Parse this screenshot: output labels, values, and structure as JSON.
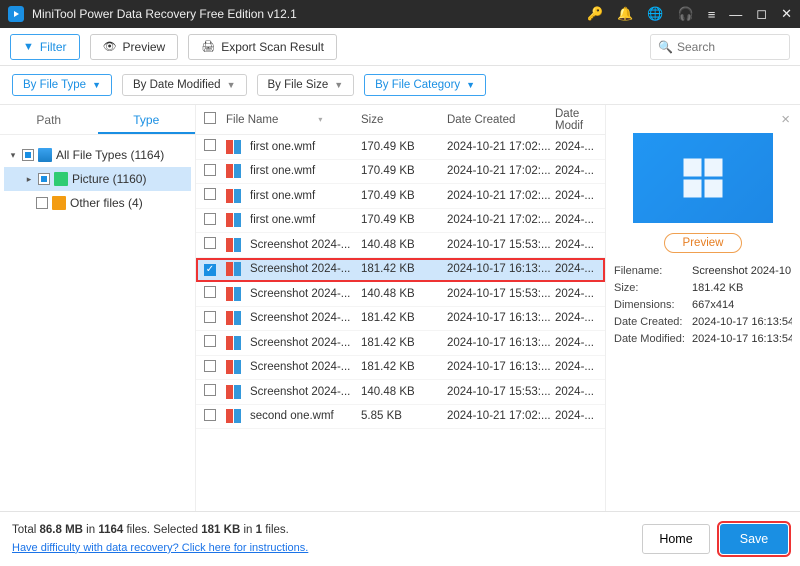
{
  "titlebar": {
    "title": "MiniTool Power Data Recovery Free Edition v12.1"
  },
  "toolbar": {
    "filter": "Filter",
    "preview": "Preview",
    "export": "Export Scan Result",
    "search_placeholder": "Search"
  },
  "chips": {
    "type": "By File Type",
    "date": "By Date Modified",
    "size": "By File Size",
    "category": "By File Category"
  },
  "tabs": {
    "path": "Path",
    "type": "Type"
  },
  "tree": {
    "all": "All File Types (1164)",
    "picture": "Picture (1160)",
    "other": "Other files (4)"
  },
  "columns": {
    "name": "File Name",
    "size": "Size",
    "created": "Date Created",
    "modified": "Date Modif"
  },
  "rows": [
    {
      "name": "first one.wmf",
      "size": "170.49 KB",
      "created": "2024-10-21 17:02:...",
      "mod": "2024-...",
      "chk": false
    },
    {
      "name": "first one.wmf",
      "size": "170.49 KB",
      "created": "2024-10-21 17:02:...",
      "mod": "2024-...",
      "chk": false
    },
    {
      "name": "first one.wmf",
      "size": "170.49 KB",
      "created": "2024-10-21 17:02:...",
      "mod": "2024-...",
      "chk": false
    },
    {
      "name": "first one.wmf",
      "size": "170.49 KB",
      "created": "2024-10-21 17:02:...",
      "mod": "2024-...",
      "chk": false
    },
    {
      "name": "Screenshot 2024-...",
      "size": "140.48 KB",
      "created": "2024-10-17 15:53:...",
      "mod": "2024-...",
      "chk": false
    },
    {
      "name": "Screenshot 2024-...",
      "size": "181.42 KB",
      "created": "2024-10-17 16:13:...",
      "mod": "2024-...",
      "chk": true,
      "sel": true
    },
    {
      "name": "Screenshot 2024-...",
      "size": "140.48 KB",
      "created": "2024-10-17 15:53:...",
      "mod": "2024-...",
      "chk": false
    },
    {
      "name": "Screenshot 2024-...",
      "size": "181.42 KB",
      "created": "2024-10-17 16:13:...",
      "mod": "2024-...",
      "chk": false
    },
    {
      "name": "Screenshot 2024-...",
      "size": "181.42 KB",
      "created": "2024-10-17 16:13:...",
      "mod": "2024-...",
      "chk": false
    },
    {
      "name": "Screenshot 2024-...",
      "size": "181.42 KB",
      "created": "2024-10-17 16:13:...",
      "mod": "2024-...",
      "chk": false
    },
    {
      "name": "Screenshot 2024-...",
      "size": "140.48 KB",
      "created": "2024-10-17 15:53:...",
      "mod": "2024-...",
      "chk": false
    },
    {
      "name": "second one.wmf",
      "size": "5.85 KB",
      "created": "2024-10-21 17:02:...",
      "mod": "2024-...",
      "chk": false
    }
  ],
  "preview": {
    "btn": "Preview",
    "meta": [
      {
        "label": "Filename:",
        "value": "Screenshot 2024-10"
      },
      {
        "label": "Size:",
        "value": "181.42 KB"
      },
      {
        "label": "Dimensions:",
        "value": "667x414"
      },
      {
        "label": "Date Created:",
        "value": "2024-10-17 16:13:54"
      },
      {
        "label": "Date Modified:",
        "value": "2024-10-17 16:13:54"
      }
    ]
  },
  "status": {
    "total_pre": "Total ",
    "total_size": "86.8 MB",
    "in1": " in ",
    "total_files": "1164",
    "files_suffix": " files.",
    "sel_pre": "   Selected ",
    "sel_size": "181 KB",
    "sel_files": "1",
    "help": "Have difficulty with data recovery? Click here for instructions.",
    "home": "Home",
    "save": "Save"
  }
}
